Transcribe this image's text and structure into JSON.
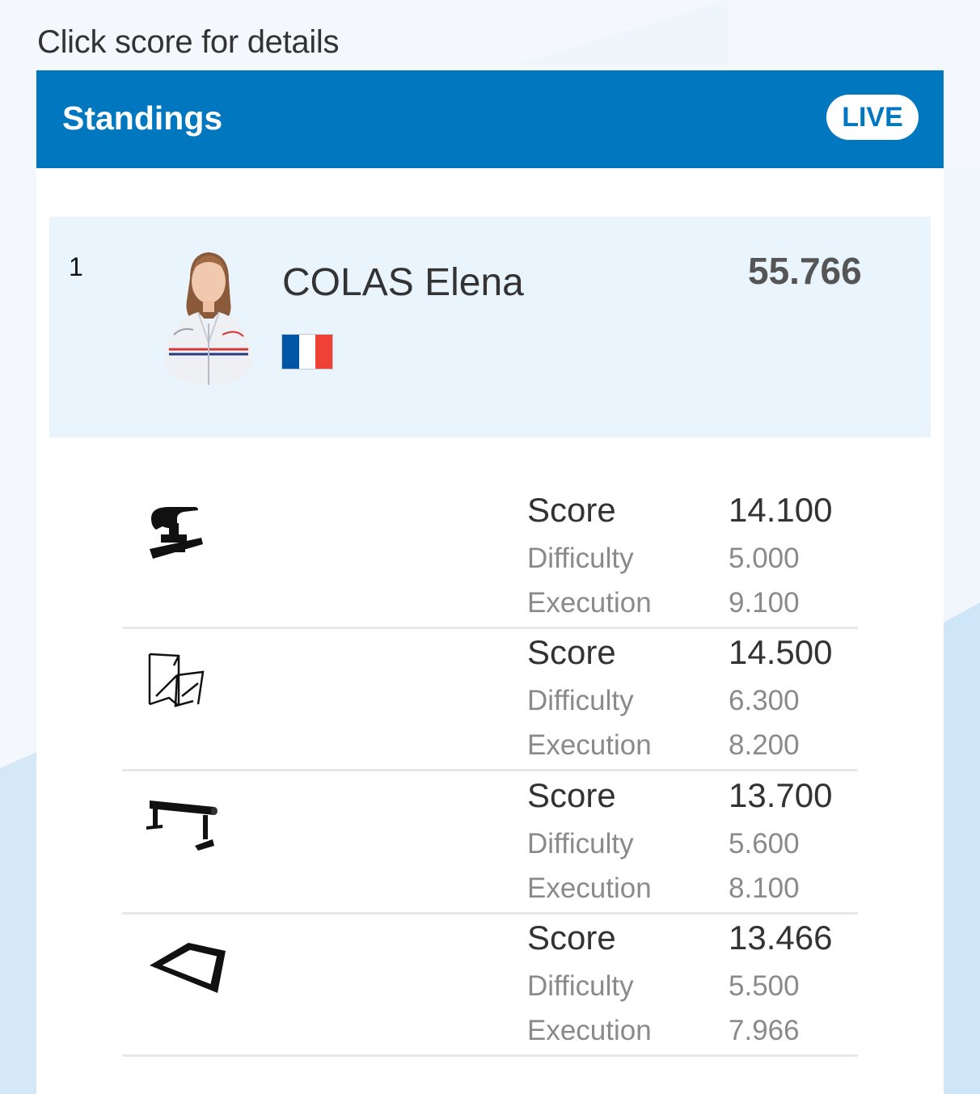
{
  "hint": "Click score for details",
  "header": {
    "title": "Standings",
    "live": "LIVE"
  },
  "athlete": {
    "rank": "1",
    "name": "COLAS Elena",
    "total": "55.766",
    "flag_colors": [
      "#0055a4",
      "#ffffff",
      "#ef4135"
    ]
  },
  "labels": {
    "score": "Score",
    "difficulty": "Difficulty",
    "execution": "Execution"
  },
  "apparatus": [
    {
      "icon": "vault-icon",
      "score": "14.100",
      "difficulty": "5.000",
      "execution": "9.100"
    },
    {
      "icon": "uneven-bars-icon",
      "score": "14.500",
      "difficulty": "6.300",
      "execution": "8.200"
    },
    {
      "icon": "balance-beam-icon",
      "score": "13.700",
      "difficulty": "5.600",
      "execution": "8.100"
    },
    {
      "icon": "floor-exercise-icon",
      "score": "13.466",
      "difficulty": "5.500",
      "execution": "7.966"
    }
  ],
  "colors": {
    "header": "#0077bf",
    "card": "#eaf4fc",
    "background": "#f4f8fc"
  }
}
